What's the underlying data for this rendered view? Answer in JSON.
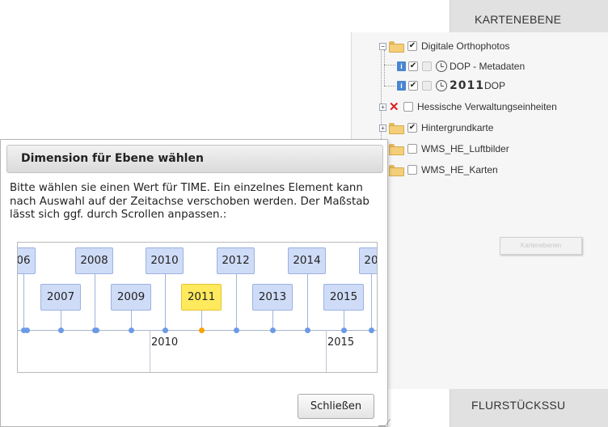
{
  "layer_panel": {
    "header_title": "KARTENEBENE",
    "tree": [
      {
        "label": "Digitale Orthophotos",
        "checked": true,
        "expanded": true
      },
      {
        "label": "DOP - Metadaten",
        "checked": true
      },
      {
        "year": "2011",
        "label": "DOP",
        "checked": true
      },
      {
        "label": "Hessische Verwaltungseinheiten",
        "checked": false,
        "icon": "red-x-icon"
      },
      {
        "label": "Hintergrundkarte",
        "checked": true
      },
      {
        "label": "WMS_HE_Luftbilder",
        "checked": false
      },
      {
        "label": "WMS_HE_Karten",
        "checked": false
      }
    ],
    "ghost_button_label": "Kartenebenen",
    "bottom_header_title": "FLURSTÜCKSSU"
  },
  "dialog": {
    "title": "Dimension für Ebene wählen",
    "description": "Bitte wählen sie einen Wert für TIME. Ein einzelnes Element kann nach Auswahl auf der Zeitachse verschoben werden. Der Maßstab lässt sich ggf. durch Scrollen anpassen.:",
    "close_label": "Schließen",
    "timeline": {
      "items_top": [
        "06",
        "2008",
        "2010",
        "2012",
        "2014",
        "20"
      ],
      "items_bottom": [
        "2007",
        "2009",
        "2011",
        "2013",
        "2015"
      ],
      "selected": "2011",
      "axis_labels": [
        "2010",
        "2015"
      ],
      "colors": {
        "item": "#cfdcf7",
        "selected": "#ffe95d",
        "dot": "#6b9ae6",
        "selected_dot": "#f5a300"
      }
    }
  }
}
